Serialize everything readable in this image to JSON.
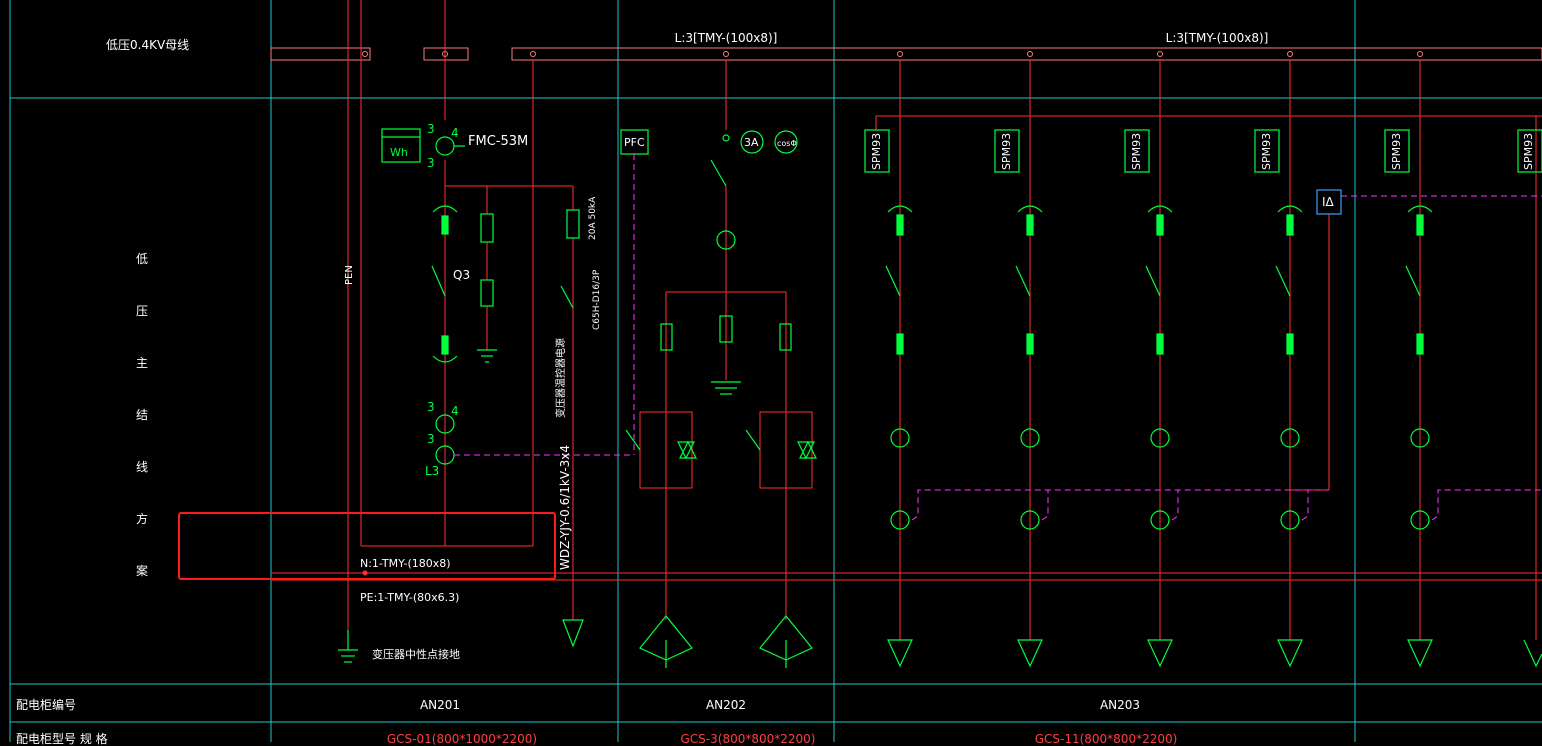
{
  "bus": {
    "row_label": "低压0.4KV母线",
    "label_left": "L:3[TMY-(100x8)]",
    "label_right": "L:3[TMY-(100x8)]"
  },
  "scheme_label_chars": [
    "低",
    "压",
    "主",
    "结",
    "线",
    "方",
    "案"
  ],
  "cabinet_an201": {
    "meter": "Wh",
    "fmc": "FMC-53M",
    "pen": "PEN",
    "q3": "Q3",
    "l3": "L3",
    "ct_ratio": "3",
    "ct_count": "4",
    "arrester": "20A 50kA",
    "breaker_spec": "C65H-D16/3P",
    "feeder_note": "变压器温控器电源",
    "cable": "WDZ-YJY-0.6/1kV-3x4",
    "n_bar": "N:1-TMY-(180x8)",
    "pe_bar": "PE:1-TMY-(80x6.3)",
    "grounding": "变压器中性点接地"
  },
  "cabinet_an202": {
    "pfc": "PFC",
    "ammeter": "3A",
    "cos": "cosΦ"
  },
  "spm_label": "SPM93",
  "leakage_label": "IΔ",
  "footer": {
    "cabinet_no_label": "配电柜编号",
    "model_label": "配电柜型号 规 格",
    "an201": "AN201",
    "an202": "AN202",
    "an203": "AN203",
    "model_an201": "GCS-01(800*1000*2200)",
    "model_an202": "GCS-3(800*800*2200)",
    "model_an203": "GCS-11(800*800*2200)"
  },
  "colors": {
    "grid": "#19c8d2",
    "wire": "#ff3030",
    "device": "#00ff3c",
    "control": "#ff33ff",
    "text": "#ffffff",
    "highlight": "#ff1a1a",
    "bus_outline": "#ff7a7a",
    "sensor": "#3aa0ff"
  }
}
